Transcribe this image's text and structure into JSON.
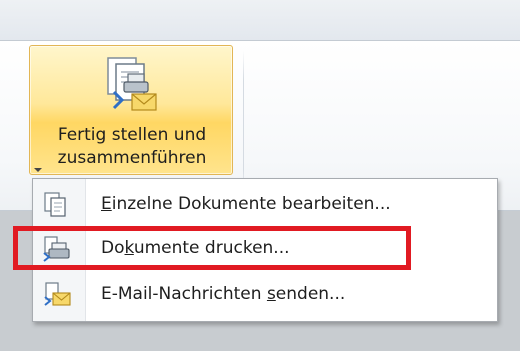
{
  "ribbon": {
    "mail_merge_button": {
      "label_line1": "Fertig stellen und",
      "label_line2": "zusammenführen",
      "icon": "finish-merge-icon"
    }
  },
  "dropdown_menu": {
    "items": [
      {
        "label_pre": "",
        "label_key": "E",
        "label_post": "inzelne Dokumente bearbeiten...",
        "icon": "edit-documents-icon"
      },
      {
        "label_pre": "Do",
        "label_key": "k",
        "label_post": "umente drucken...",
        "icon": "print-documents-icon"
      },
      {
        "label_pre": "E-Mail-Nachrichten ",
        "label_key": "s",
        "label_post": "enden...",
        "icon": "send-email-icon"
      }
    ]
  },
  "annotation": {
    "highlight_color": "#e11a22",
    "highlighted_item": "Dokumente drucken..."
  },
  "colors": {
    "button_hover": "#ffe48d",
    "button_border": "#e2b655",
    "menu_border": "#a7abb0"
  }
}
